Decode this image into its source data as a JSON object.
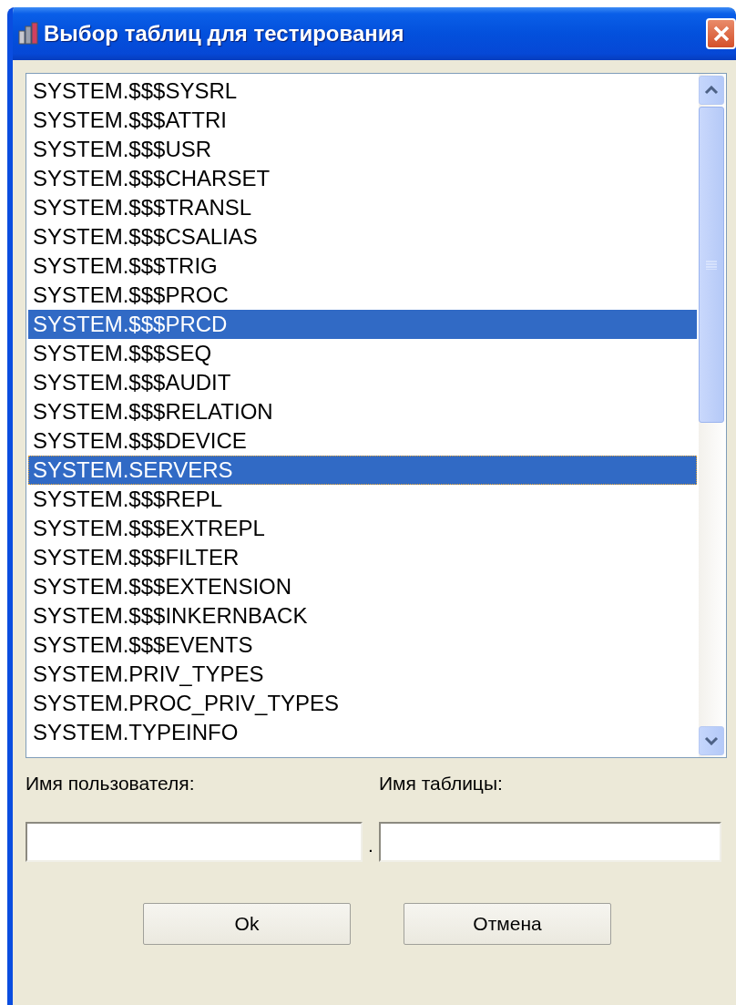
{
  "window": {
    "title": "Выбор таблиц для тестирования"
  },
  "tables": [
    {
      "name": "SYSTEM.$$$SYSRL",
      "selected": false,
      "focused": false
    },
    {
      "name": "SYSTEM.$$$ATTRI",
      "selected": false,
      "focused": false
    },
    {
      "name": "SYSTEM.$$$USR",
      "selected": false,
      "focused": false
    },
    {
      "name": "SYSTEM.$$$CHARSET",
      "selected": false,
      "focused": false
    },
    {
      "name": "SYSTEM.$$$TRANSL",
      "selected": false,
      "focused": false
    },
    {
      "name": "SYSTEM.$$$CSALIAS",
      "selected": false,
      "focused": false
    },
    {
      "name": "SYSTEM.$$$TRIG",
      "selected": false,
      "focused": false
    },
    {
      "name": "SYSTEM.$$$PROC",
      "selected": false,
      "focused": false
    },
    {
      "name": "SYSTEM.$$$PRCD",
      "selected": true,
      "focused": false
    },
    {
      "name": "SYSTEM.$$$SEQ",
      "selected": false,
      "focused": false
    },
    {
      "name": "SYSTEM.$$$AUDIT",
      "selected": false,
      "focused": false
    },
    {
      "name": "SYSTEM.$$$RELATION",
      "selected": false,
      "focused": false
    },
    {
      "name": "SYSTEM.$$$DEVICE",
      "selected": false,
      "focused": false
    },
    {
      "name": "SYSTEM.SERVERS",
      "selected": true,
      "focused": true
    },
    {
      "name": "SYSTEM.$$$REPL",
      "selected": false,
      "focused": false
    },
    {
      "name": "SYSTEM.$$$EXTREPL",
      "selected": false,
      "focused": false
    },
    {
      "name": "SYSTEM.$$$FILTER",
      "selected": false,
      "focused": false
    },
    {
      "name": "SYSTEM.$$$EXTENSION",
      "selected": false,
      "focused": false
    },
    {
      "name": "SYSTEM.$$$INKERNBACK",
      "selected": false,
      "focused": false
    },
    {
      "name": "SYSTEM.$$$EVENTS",
      "selected": false,
      "focused": false
    },
    {
      "name": "SYSTEM.PRIV_TYPES",
      "selected": false,
      "focused": false
    },
    {
      "name": "SYSTEM.PROC_PRIV_TYPES",
      "selected": false,
      "focused": false
    },
    {
      "name": "SYSTEM.TYPEINFO",
      "selected": false,
      "focused": false
    }
  ],
  "user_name": {
    "label": "Имя пользователя:"
  },
  "separator": ".",
  "table_name": {
    "label": "Имя таблицы:"
  },
  "buttons": [
    "Ok",
    "Отмена"
  ]
}
